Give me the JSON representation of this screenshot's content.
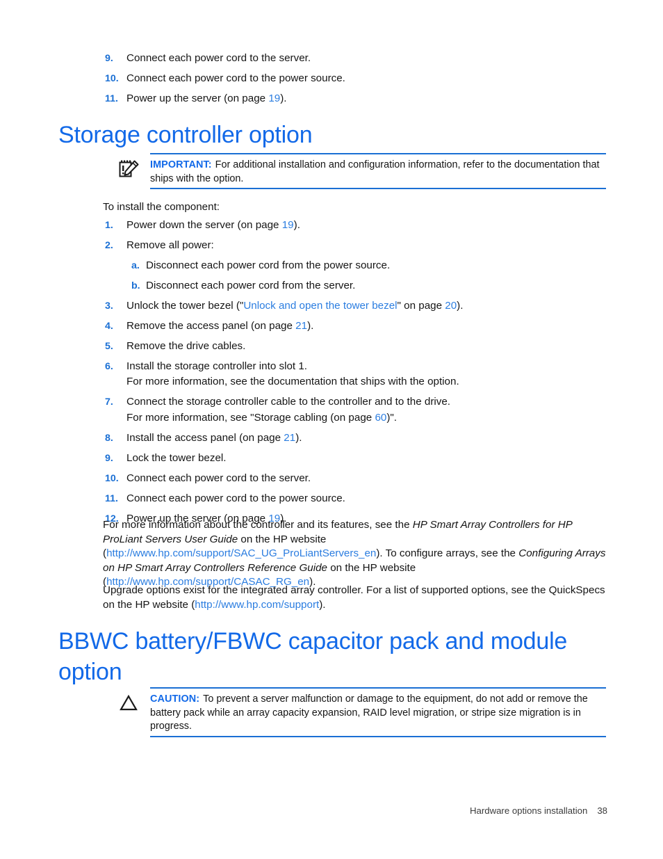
{
  "document": {
    "footer_text": "Hardware options installation",
    "page_number": "38"
  },
  "colors": {
    "heading_blue": "#1269e8",
    "list_number_blue": "#1a6fd4",
    "link_blue": "#2b7de0",
    "rule_blue": "#1a6fd4",
    "body_text": "#151515"
  },
  "top_list": {
    "items": [
      {
        "num": "9.",
        "text": "Connect each power cord to the server."
      },
      {
        "num": "10.",
        "text": "Connect each power cord to the power source."
      },
      {
        "num": "11.",
        "text_before": "Power up the server (on page ",
        "pageref": "19",
        "text_after": ")."
      }
    ]
  },
  "storage_section": {
    "heading": "Storage controller option",
    "note": {
      "icon": "important-notepad-icon",
      "label": "IMPORTANT:",
      "text": "For additional installation and configuration information, refer to the documentation that ships with the option."
    },
    "intro": "To install the component:",
    "steps": [
      {
        "num": "1.",
        "text_before": "Power down the server (on page ",
        "pageref": "19",
        "text_after": ")."
      },
      {
        "num": "2.",
        "text": "Remove all power:",
        "substeps": [
          {
            "num": "a.",
            "text": "Disconnect each power cord from the power source."
          },
          {
            "num": "b.",
            "text": "Disconnect each power cord from the server."
          }
        ]
      },
      {
        "num": "3.",
        "text_before": "Unlock the tower bezel (\"",
        "link": "Unlock and open the tower bezel",
        "text_mid": "\" on page ",
        "pageref": "20",
        "text_after": ")."
      },
      {
        "num": "4.",
        "text_before": "Remove the access panel (on page ",
        "pageref": "21",
        "text_after": ")."
      },
      {
        "num": "5.",
        "text": "Remove the drive cables."
      },
      {
        "num": "6.",
        "text": "Install the storage controller into slot 1.",
        "continuation": "For more information, see the documentation that ships with the option."
      },
      {
        "num": "7.",
        "text": "Connect the storage controller cable to the controller and to the drive.",
        "continuation_before": "For more information, see \"Storage cabling (on page ",
        "continuation_pageref": "60",
        "continuation_after": ")\"."
      },
      {
        "num": "8.",
        "text_before": "Install the access panel (on page ",
        "pageref": "21",
        "text_after": ")."
      },
      {
        "num": "9.",
        "text": "Lock the tower bezel."
      },
      {
        "num": "10.",
        "text": "Connect each power cord to the server."
      },
      {
        "num": "11.",
        "text": "Connect each power cord to the power source."
      },
      {
        "num": "12.",
        "text_before": "Power up the server (on page ",
        "pageref": "19",
        "text_after": ")."
      }
    ],
    "paragraph_1": {
      "p1": "For more information about the controller and its features, see the ",
      "italic1": "HP Smart Array Controllers for HP ProLiant Servers User Guide",
      "p2": " on the HP website (",
      "url1": "http://www.hp.com/support/SAC_UG_ProLiantServers_en",
      "p3": "). To configure arrays, see the ",
      "italic2": "Configuring Arrays on HP Smart Array Controllers Reference Guide",
      "p4": " on the HP website (",
      "url2": "http://www.hp.com/support/CASAC_RG_en",
      "p5": ")."
    },
    "paragraph_2": {
      "p1": "Upgrade options exist for the integrated array controller. For a list of supported options, see the QuickSpecs on the HP website (",
      "url1": "http://www.hp.com/support",
      "p2": ")."
    }
  },
  "bbwc_section": {
    "heading": "BBWC battery/FBWC capacitor pack and module option",
    "caution": {
      "icon": "caution-triangle-icon",
      "label": "CAUTION:",
      "text": "To prevent a server malfunction or damage to the equipment, do not add or remove the battery pack while an array capacity expansion, RAID level migration, or stripe size migration is in progress."
    }
  }
}
